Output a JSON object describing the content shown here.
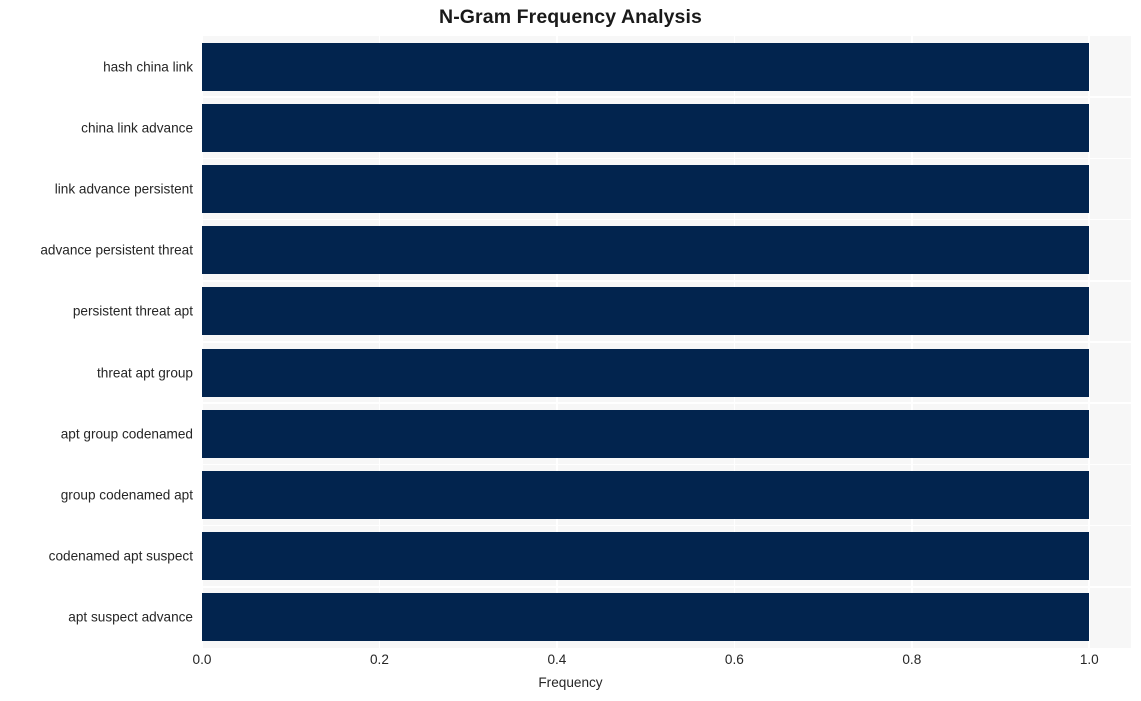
{
  "chart_data": {
    "type": "bar",
    "orientation": "horizontal",
    "title": "N-Gram Frequency Analysis",
    "xlabel": "Frequency",
    "ylabel": "",
    "categories": [
      "hash china link",
      "china link advance",
      "link advance persistent",
      "advance persistent threat",
      "persistent threat apt",
      "threat apt group",
      "apt group codenamed",
      "group codenamed apt",
      "codenamed apt suspect",
      "apt suspect advance"
    ],
    "values": [
      1.0,
      1.0,
      1.0,
      1.0,
      1.0,
      1.0,
      1.0,
      1.0,
      1.0,
      1.0
    ],
    "xlim": [
      0.0,
      1.047
    ],
    "xticks": [
      "0.0",
      "0.2",
      "0.4",
      "0.6",
      "0.8",
      "1.0"
    ],
    "xtick_values": [
      0.0,
      0.2,
      0.4,
      0.6,
      0.8,
      1.0
    ],
    "grid": true,
    "legend": null,
    "bar_color": "#02244e",
    "plot_background": "#f7f7f7",
    "gridline_color": "#ffffff",
    "figure_background": "#ffffff"
  }
}
